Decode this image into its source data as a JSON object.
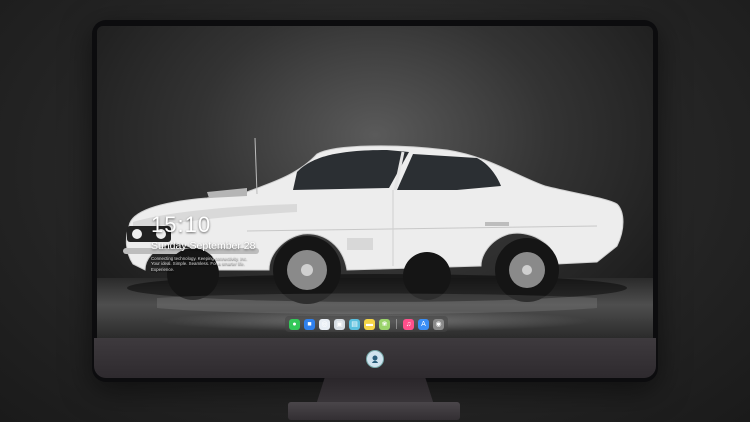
{
  "lock_screen": {
    "time": "15:10",
    "date": "Sunday September 28",
    "notice_line1": "Connecting technology. Keeping connectivity. Inc.",
    "notice_line2": "Your ideal. Simple. Seamless. For a smarter life. Experience."
  },
  "dock": {
    "apps": [
      {
        "name": "messages-icon",
        "color": "#34c759",
        "glyph": "●"
      },
      {
        "name": "finder-icon",
        "color": "#2f80ed",
        "glyph": "■"
      },
      {
        "name": "safari-icon",
        "color": "#e8eef5",
        "glyph": "◎"
      },
      {
        "name": "preview-icon",
        "color": "#d7dde3",
        "glyph": "▣"
      },
      {
        "name": "claquette-icon",
        "color": "#5bc0de",
        "glyph": "▤"
      },
      {
        "name": "notes-icon",
        "color": "#f5d547",
        "glyph": "▬"
      },
      {
        "name": "photos-icon",
        "color": "#9ad36a",
        "glyph": "❀"
      },
      {
        "name": "music-icon",
        "color": "#ff4f8b",
        "glyph": "♫"
      },
      {
        "name": "app-store-icon",
        "color": "#3a8ef6",
        "glyph": "A"
      },
      {
        "name": "camera-icon",
        "color": "#8a8a8a",
        "glyph": "◉"
      }
    ]
  }
}
